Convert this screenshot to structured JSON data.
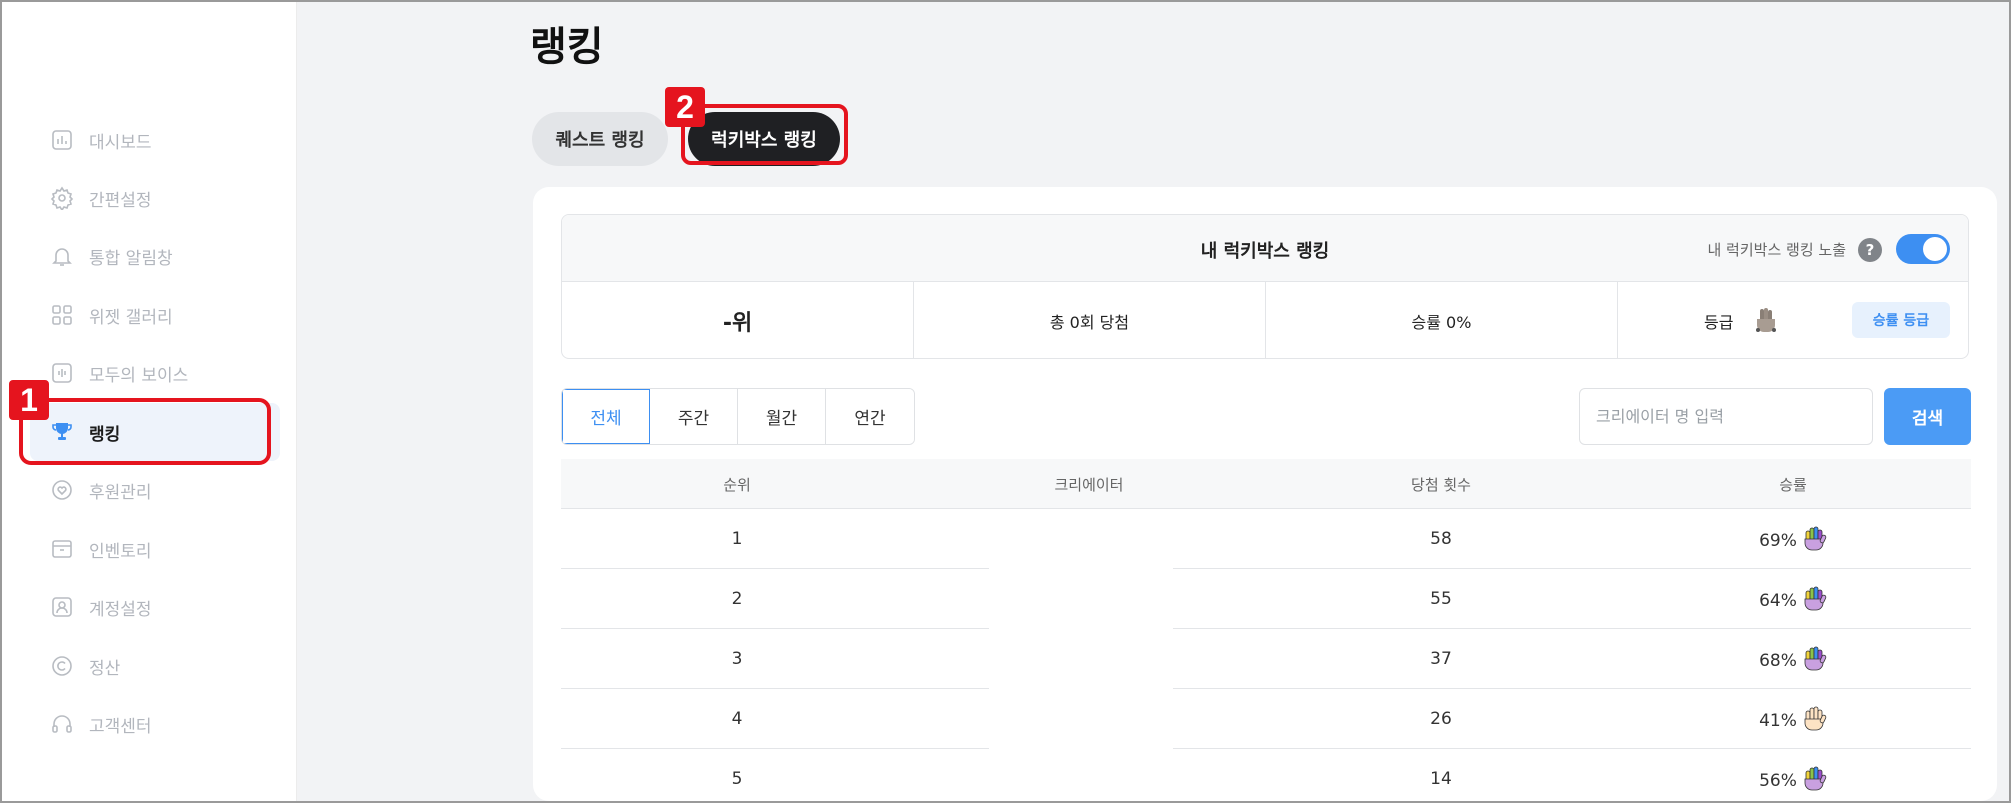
{
  "sidebar": {
    "items": [
      {
        "label": "대시보드",
        "icon": "chart-icon"
      },
      {
        "label": "간편설정",
        "icon": "gear-icon"
      },
      {
        "label": "통합 알림창",
        "icon": "bell-icon"
      },
      {
        "label": "위젯 갤러리",
        "icon": "grid-icon"
      },
      {
        "label": "모두의 보이스",
        "icon": "voice-icon"
      },
      {
        "label": "랭킹",
        "icon": "trophy-icon",
        "active": true
      },
      {
        "label": "후원관리",
        "icon": "heart-icon"
      },
      {
        "label": "인벤토리",
        "icon": "inventory-icon"
      },
      {
        "label": "계정설정",
        "icon": "account-icon"
      },
      {
        "label": "정산",
        "icon": "copyright-icon"
      },
      {
        "label": "고객센터",
        "icon": "headset-icon"
      }
    ]
  },
  "callouts": {
    "one": "1",
    "two": "2"
  },
  "page": {
    "title": "랭킹"
  },
  "tabs": {
    "quest": "퀘스트 랭킹",
    "lucky": "럭키박스 랭킹"
  },
  "my_ranking": {
    "title": "내 럭키박스 랭킹",
    "expose_label": "내 럭키박스 랭킹 노출",
    "help": "?",
    "expose_on": true,
    "rank": "-위",
    "wins": "총 0회 당첨",
    "win_rate": "승률 0%",
    "grade_label": "등급",
    "grade_button": "승률 등급"
  },
  "filters": {
    "periods": [
      "전체",
      "주간",
      "월간",
      "연간"
    ],
    "active_period": "전체",
    "search_placeholder": "크리에이터 명 입력",
    "search_button": "검색"
  },
  "table": {
    "headers": {
      "rank": "순위",
      "creator": "크리에이터",
      "wins": "당첨 횟수",
      "rate": "승률"
    },
    "rows": [
      {
        "rank": "1",
        "creator": "",
        "wins": "58",
        "rate": "69%",
        "icon": "rainbow-hand-icon"
      },
      {
        "rank": "2",
        "creator": "",
        "wins": "55",
        "rate": "64%",
        "icon": "rainbow-hand-icon"
      },
      {
        "rank": "3",
        "creator": "",
        "wins": "37",
        "rate": "68%",
        "icon": "rainbow-hand-icon"
      },
      {
        "rank": "4",
        "creator": "",
        "wins": "26",
        "rate": "41%",
        "icon": "skin-hand-icon"
      },
      {
        "rank": "5",
        "creator": "",
        "wins": "14",
        "rate": "56%",
        "icon": "rainbow-hand-icon"
      }
    ]
  },
  "colors": {
    "accent": "#3d8ff2",
    "callout": "#e5141e",
    "dark_tab": "#1f2023"
  }
}
